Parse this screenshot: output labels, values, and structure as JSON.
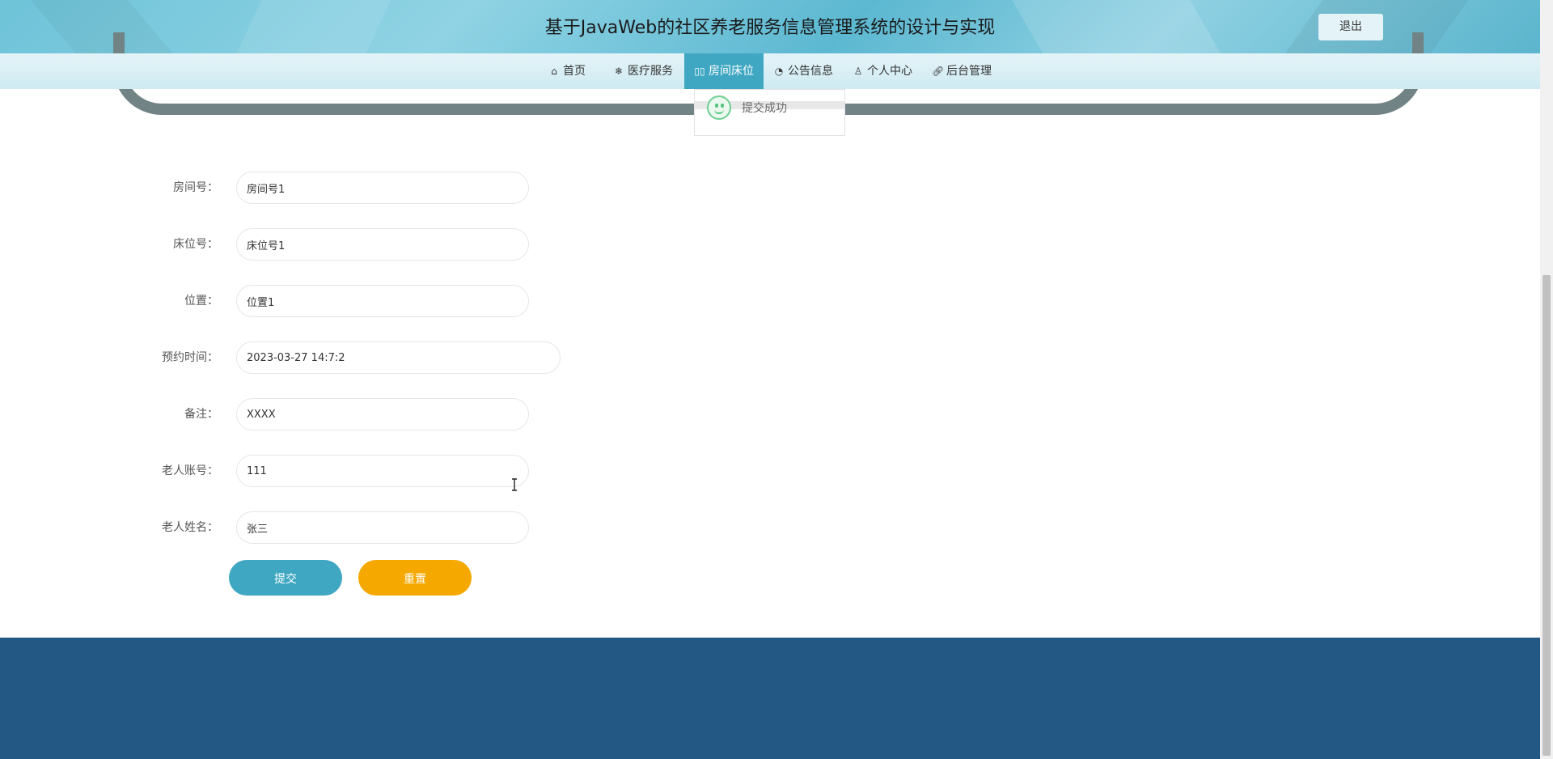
{
  "header": {
    "title": "基于JavaWeb的社区养老服务信息管理系统的设计与实现",
    "logout_label": "退出"
  },
  "nav": {
    "items": [
      {
        "label": "首页",
        "icon": "home-icon"
      },
      {
        "label": "医疗服务",
        "icon": "snowflake-icon"
      },
      {
        "label": "房间床位",
        "icon": "book-icon",
        "active": true
      },
      {
        "label": "公告信息",
        "icon": "palette-icon"
      },
      {
        "label": "个人中心",
        "icon": "user-icon"
      },
      {
        "label": "后台管理",
        "icon": "link-icon"
      }
    ]
  },
  "toast": {
    "message": "提交成功"
  },
  "form": {
    "fields": [
      {
        "label": "房间号：",
        "value": "房间号1"
      },
      {
        "label": "床位号：",
        "value": "床位号1"
      },
      {
        "label": "位置：",
        "value": "位置1"
      },
      {
        "label": "预约时间：",
        "value": "2023-03-27 14:7:2"
      },
      {
        "label": "备注：",
        "value": "XXXX"
      },
      {
        "label": "老人账号：",
        "value": "111"
      },
      {
        "label": "老人姓名：",
        "value": "张三"
      }
    ],
    "submit_label": "提交",
    "reset_label": "重置"
  },
  "colors": {
    "primary": "#3fa7c2",
    "reset": "#f5a800",
    "footer": "#235885"
  }
}
